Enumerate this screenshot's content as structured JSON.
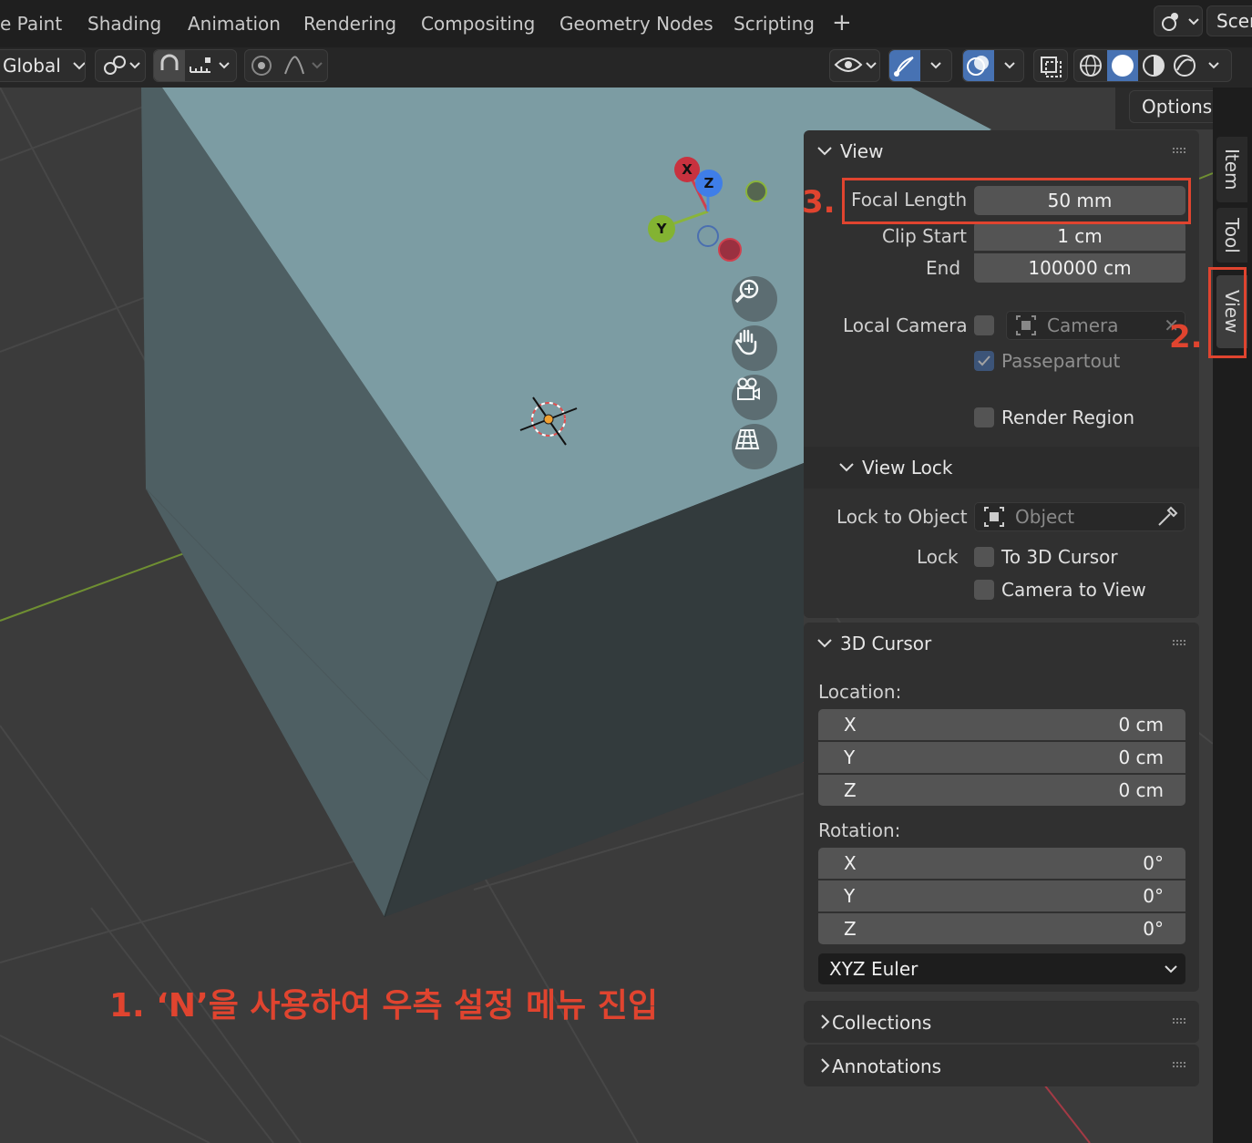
{
  "workspace_tabs": [
    "e Paint",
    "Shading",
    "Animation",
    "Rendering",
    "Compositing",
    "Geometry Nodes",
    "Scripting",
    "+"
  ],
  "scene_label": "Scen",
  "toolbar": {
    "transform_orientation": "Global",
    "options_label": "Options"
  },
  "gizmo": {
    "x_label": "X",
    "y_label": "Y",
    "z_label": "Z"
  },
  "sidebar_tabs": [
    "Item",
    "Tool",
    "View"
  ],
  "view_panel": {
    "title": "View",
    "focal_length_label": "Focal Length",
    "focal_length_value": "50 mm",
    "clip_start_label": "Clip Start",
    "clip_start_value": "1 cm",
    "clip_end_label": "End",
    "clip_end_value": "100000 cm",
    "local_camera_label": "Local Camera",
    "camera_placeholder": "Camera",
    "passepartout_label": "Passepartout",
    "render_region_label": "Render Region"
  },
  "view_lock": {
    "title": "View Lock",
    "lock_to_object_label": "Lock to Object",
    "object_placeholder": "Object",
    "lock_label": "Lock",
    "to_3d_cursor_label": "To 3D Cursor",
    "camera_to_view_label": "Camera to View"
  },
  "cursor_panel": {
    "title": "3D Cursor",
    "location_label": "Location:",
    "location": [
      {
        "axis": "X",
        "value": "0 cm"
      },
      {
        "axis": "Y",
        "value": "0 cm"
      },
      {
        "axis": "Z",
        "value": "0 cm"
      }
    ],
    "rotation_label": "Rotation:",
    "rotation": [
      {
        "axis": "X",
        "value": "0°"
      },
      {
        "axis": "Y",
        "value": "0°"
      },
      {
        "axis": "Z",
        "value": "0°"
      }
    ],
    "rotation_mode": "XYZ Euler"
  },
  "collapsed_panels": {
    "collections": "Collections",
    "annotations": "Annotations"
  },
  "annotations": {
    "step1": "1. ‘N’을 사용하여 우측 설정 메뉴 진입",
    "step2": "2.",
    "step3": "3."
  },
  "colors": {
    "annotation_red": "#e0442f",
    "panel_bg": "#303030",
    "field_bg": "#545454",
    "cube_top": "#7d9ea5",
    "selected_toggle": "#4772b3"
  }
}
